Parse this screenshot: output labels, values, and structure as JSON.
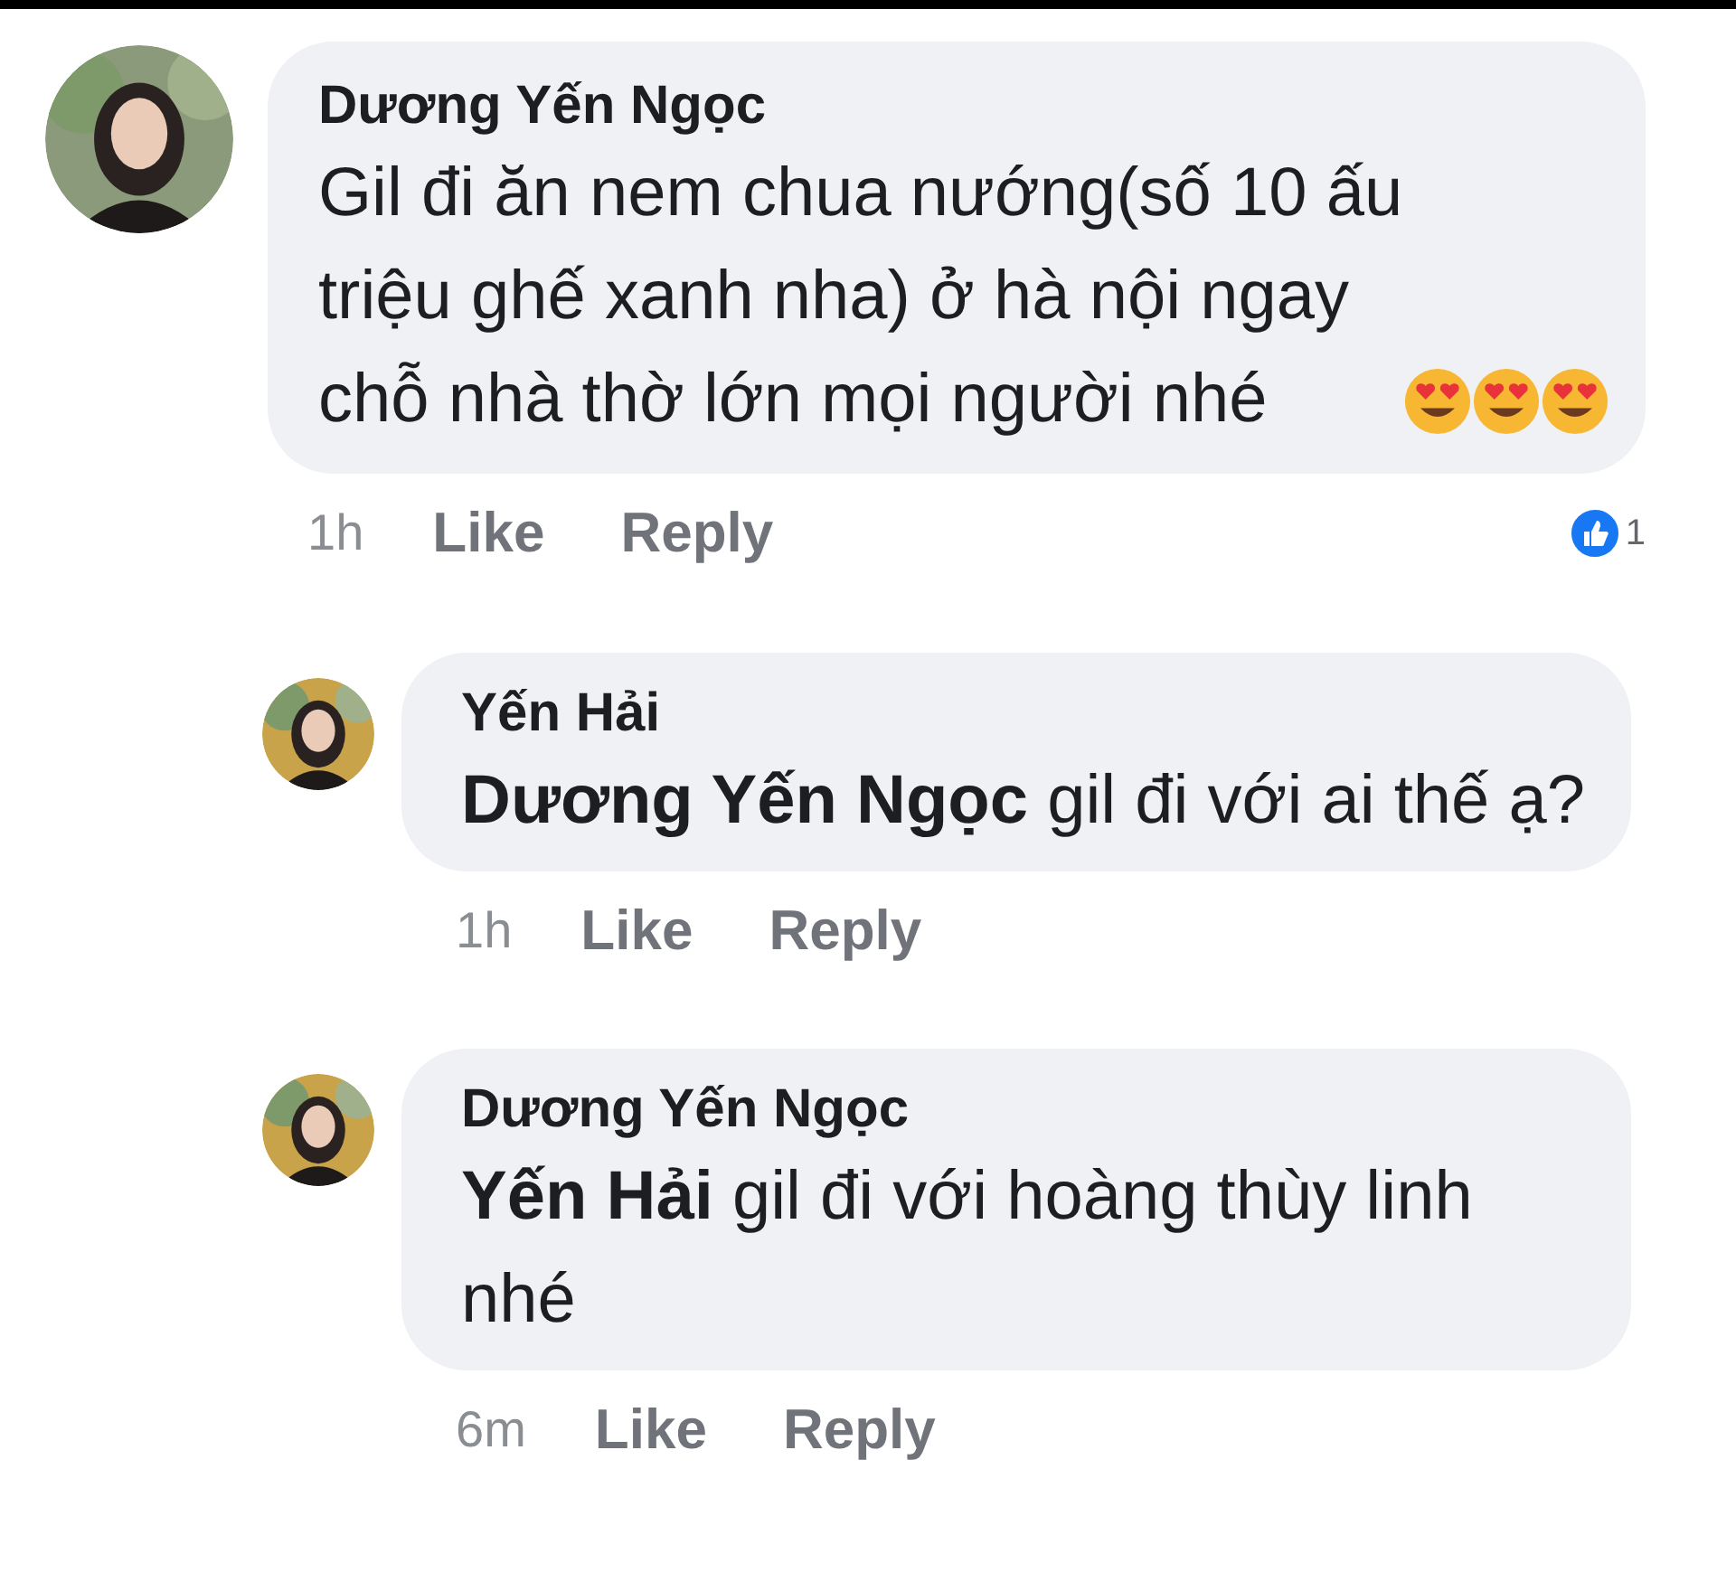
{
  "comments": [
    {
      "author": "Dương Yến Ngọc",
      "text": "Gil đi ăn nem chua nướng(số 10 ấu triệu ghế xanh nha) ở hà nội ngay chỗ nhà thờ lớn mọi người nhé",
      "emojis": [
        {
          "kind": "heart-eyes"
        },
        {
          "kind": "heart-eyes"
        },
        {
          "kind": "heart-eyes"
        }
      ],
      "time": "1h",
      "actions": [
        "Like",
        "Reply"
      ],
      "reaction": {
        "kind": "like",
        "count": "1"
      },
      "replies": [
        {
          "author": "Yến Hải",
          "text": "**Dương Yến Ngọc**  gil đi với ai thế ạ?",
          "time": "1h",
          "actions": [
            "Like",
            "Reply"
          ]
        },
        {
          "author": "Dương Yến Ngọc",
          "text": "**Yến Hải** gil đi với hoàng thùy linh nhé",
          "time": "6m",
          "actions": [
            "Like",
            "Reply"
          ]
        }
      ]
    }
  ]
}
